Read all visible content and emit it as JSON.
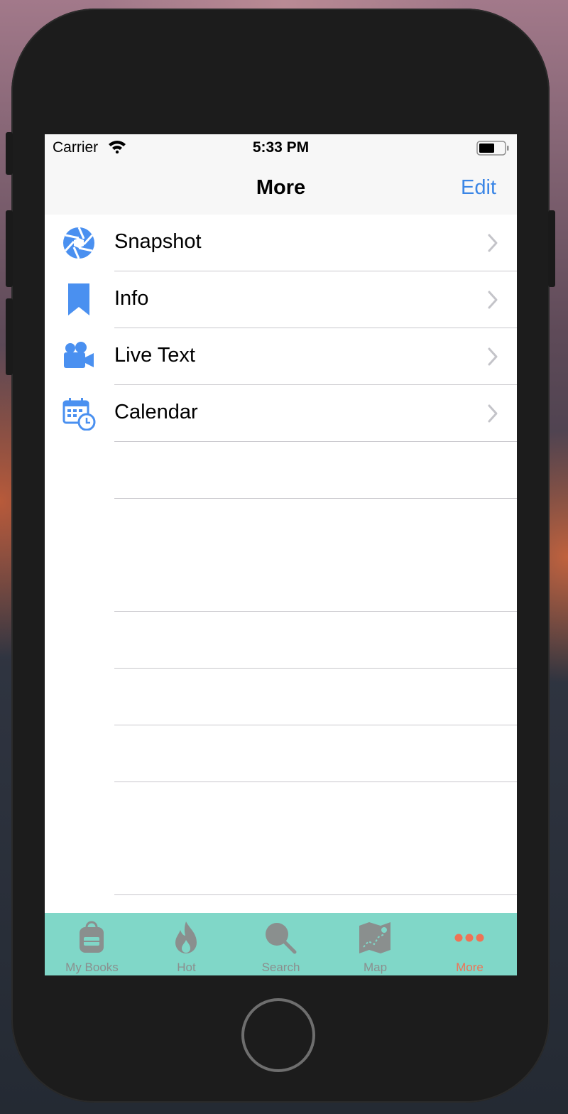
{
  "status_bar": {
    "carrier": "Carrier",
    "time": "5:33 PM"
  },
  "nav": {
    "title": "More",
    "edit_label": "Edit"
  },
  "list": {
    "items": [
      {
        "label": "Snapshot",
        "icon": "aperture-icon"
      },
      {
        "label": "Info",
        "icon": "bookmark-icon"
      },
      {
        "label": "Live Text",
        "icon": "video-camera-icon"
      },
      {
        "label": "Calendar",
        "icon": "calendar-clock-icon"
      }
    ]
  },
  "tab_bar": {
    "tabs": [
      {
        "label": "My Books",
        "icon": "backpack-icon"
      },
      {
        "label": "Hot",
        "icon": "flame-icon"
      },
      {
        "label": "Search",
        "icon": "search-icon"
      },
      {
        "label": "Map",
        "icon": "map-icon"
      },
      {
        "label": "More",
        "icon": "more-dots-icon",
        "active": true
      }
    ]
  },
  "colors": {
    "accent": "#3b86e6",
    "icon_blue": "#4a90f0",
    "tab_bar_bg": "#80d7c8",
    "tab_inactive": "#8a8f8e",
    "tab_active": "#ee7356"
  }
}
